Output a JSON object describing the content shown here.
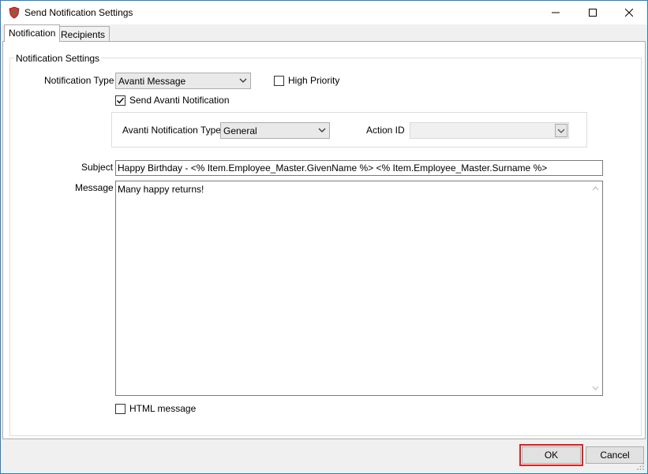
{
  "window": {
    "title": "Send Notification Settings",
    "buttons": {
      "minimize": "minimize-icon",
      "maximize": "maximize-icon",
      "close": "close-icon"
    }
  },
  "tabs": [
    {
      "label": "Notification",
      "active": true
    },
    {
      "label": "Recipients",
      "active": false
    }
  ],
  "settings": {
    "group_title": "Notification Settings",
    "notification_type_label": "Notification Type",
    "notification_type_value": "Avanti Message",
    "high_priority_label": "High Priority",
    "high_priority_checked": false,
    "send_avanti_label": "Send Avanti Notification",
    "send_avanti_checked": true,
    "avanti_type_label": "Avanti Notification Type",
    "avanti_type_value": "General",
    "action_id_label": "Action ID",
    "action_id_value": "",
    "subject_label": "Subject",
    "subject_value": "Happy Birthday - <% Item.Employee_Master.GivenName %> <% Item.Employee_Master.Surname %>",
    "message_label": "Message",
    "message_value": "Many happy returns!",
    "html_message_label": "HTML message",
    "html_message_checked": false
  },
  "footer": {
    "ok_label": "OK",
    "cancel_label": "Cancel"
  },
  "colors": {
    "highlight": "#e02020",
    "window_border": "#1883d7"
  }
}
